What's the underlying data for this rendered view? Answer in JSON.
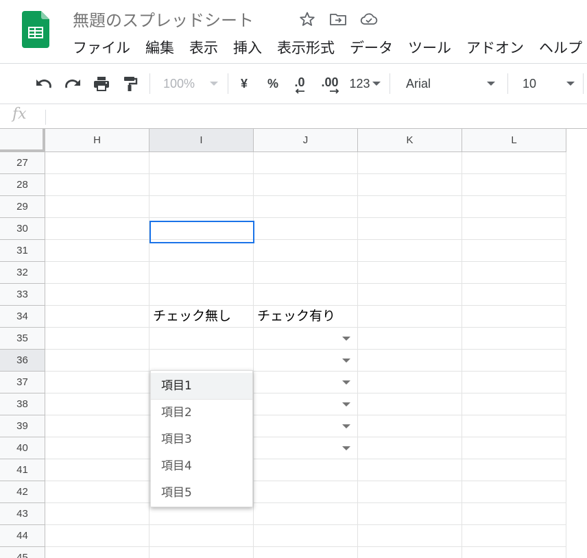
{
  "app": {
    "doc_title": "無題のスプレッドシート",
    "menu": [
      "ファイル",
      "編集",
      "表示",
      "挿入",
      "表示形式",
      "データ",
      "ツール",
      "アドオン",
      "ヘルプ"
    ]
  },
  "toolbar": {
    "zoom": "100%",
    "currency": "¥",
    "percent": "%",
    "decrease_decimal": ".0",
    "increase_decimal": ".00",
    "more_formats": "123",
    "font": "Arial",
    "font_size": "10"
  },
  "formula_bar": {
    "label": "fx",
    "value": ""
  },
  "columns": [
    "H",
    "I",
    "J",
    "K",
    "L"
  ],
  "rows": [
    "27",
    "28",
    "29",
    "30",
    "31",
    "32",
    "33",
    "34",
    "35",
    "36",
    "37",
    "38",
    "39",
    "40",
    "41",
    "42",
    "43",
    "44",
    "45"
  ],
  "cells": {
    "I34": "チェック無し",
    "J34": "チェック有り"
  },
  "dropdown_items": [
    "項目1",
    "項目2",
    "項目3",
    "項目4",
    "項目5"
  ],
  "colors": {
    "accent": "#1a73e8",
    "sheets_green": "#0f9d58"
  }
}
